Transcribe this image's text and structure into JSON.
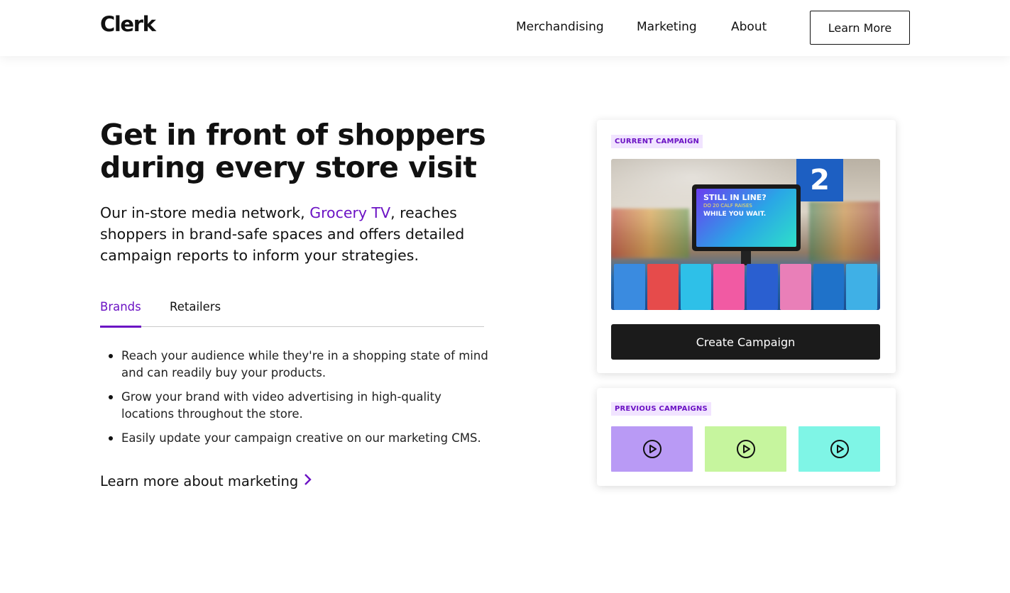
{
  "header": {
    "logo": "Clerk",
    "nav": [
      "Merchandising",
      "Marketing",
      "About"
    ],
    "cta_label": "Learn More"
  },
  "hero": {
    "title": "Get in front of shoppers during every store visit",
    "desc_before": "Our in-store media network, ",
    "desc_link": "Grocery TV",
    "desc_after": ", reaches shoppers in brand-safe spaces and offers detailed campaign reports to inform your strategies.",
    "tabs": [
      {
        "label": "Brands",
        "active": true
      },
      {
        "label": "Retailers",
        "active": false
      }
    ],
    "bullets": [
      "Reach your audience while they're in a shopping state of mind and can readily buy your products.",
      "Grow your brand with video advertising in high-quality locations throughout the store.",
      "Easily update your campaign creative on our marketing CMS."
    ],
    "more_link": "Learn more about marketing"
  },
  "current_campaign": {
    "tag": "CURRENT CAMPAIGN",
    "screen_line1": "STILL IN LINE?",
    "screen_line2": "DO 20 CALF RAISES",
    "screen_line3": "WHILE YOU WAIT.",
    "aisle_number": "2",
    "button_label": "Create Campaign"
  },
  "previous_campaigns": {
    "tag": "PREVIOUS CAMPAIGNS",
    "thumb_colors": [
      "#b99af5",
      "#c6f59e",
      "#7ff5e6"
    ],
    "thumb_icon": "play-circle-icon"
  },
  "colors": {
    "accent": "#6b12c4",
    "button_dark": "#1b1b1b"
  }
}
